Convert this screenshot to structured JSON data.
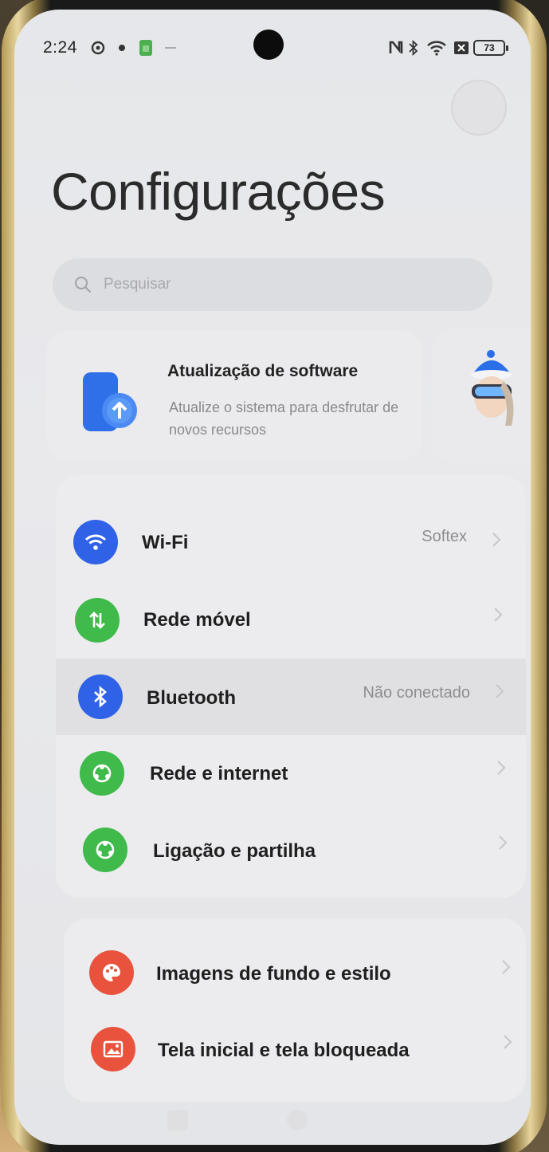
{
  "statusbar": {
    "time": "2:24",
    "battery": "73",
    "icons_left": [
      "settings-gear-icon",
      "notification-dot-icon",
      "sim-card-icon",
      "dash-icon"
    ],
    "icons_right": [
      "nfc-icon",
      "bluetooth-icon",
      "wifi-icon",
      "x-box-icon",
      "battery-icon"
    ]
  },
  "header": {
    "title": "Configurações"
  },
  "search": {
    "placeholder": "Pesquisar"
  },
  "update_card": {
    "title": "Atualização de software",
    "description": "Atualize o sistema para desfrutar de novos recursos"
  },
  "group1": {
    "items": [
      {
        "label": "Wi-Fi",
        "value": "Softex",
        "icon": "wifi-icon",
        "color": "#2f62e6"
      },
      {
        "label": "Rede móvel",
        "value": "",
        "icon": "mobile-data-icon",
        "color": "#3fba4b"
      },
      {
        "label": "Bluetooth",
        "value": "Não conectado",
        "icon": "bluetooth-icon",
        "color": "#2f62e6"
      },
      {
        "label": "Rede e internet",
        "value": "",
        "icon": "network-icon",
        "color": "#3fba4b"
      },
      {
        "label": "Ligação e partilha",
        "value": "",
        "icon": "share-icon",
        "color": "#3fba4b"
      }
    ]
  },
  "group2": {
    "items": [
      {
        "label": "Imagens de fundo e estilo",
        "icon": "palette-icon",
        "color": "#e9533e"
      },
      {
        "label": "Tela inicial e tela bloqueada",
        "icon": "image-icon",
        "color": "#e9533e"
      }
    ]
  }
}
